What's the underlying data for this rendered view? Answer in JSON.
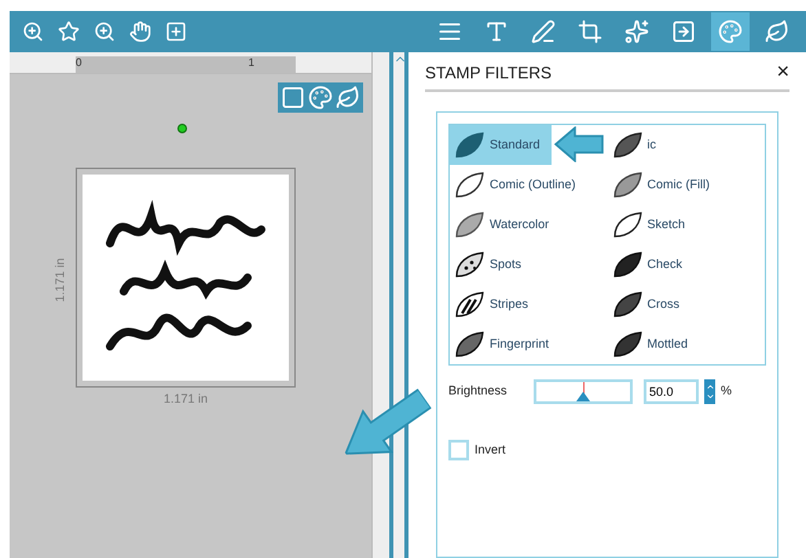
{
  "toolbar": {
    "left_tools": [
      {
        "selected": false
      },
      {
        "selected": false
      },
      {
        "selected": false
      },
      {
        "selected": false
      },
      {
        "selected": false
      }
    ],
    "right_tools": [
      {
        "selected": false
      },
      {
        "selected": false
      },
      {
        "selected": false
      },
      {
        "selected": false
      },
      {
        "selected": false
      },
      {
        "selected": false
      },
      {
        "selected": true
      },
      {
        "selected": false
      }
    ]
  },
  "ruler": {
    "labels": [
      "0",
      "1"
    ]
  },
  "canvas": {
    "width_label": "1.171 in",
    "height_label": "1.171 in"
  },
  "panel": {
    "title": "STAMP FILTERS",
    "close": "×",
    "filters": [
      {
        "label": "Standard",
        "selected": true
      },
      {
        "label": "ic",
        "selected": false
      },
      {
        "label": "Comic (Outline)",
        "selected": false
      },
      {
        "label": "Comic (Fill)",
        "selected": false
      },
      {
        "label": "Watercolor",
        "selected": false
      },
      {
        "label": "Sketch",
        "selected": false
      },
      {
        "label": "Spots",
        "selected": false
      },
      {
        "label": "Check",
        "selected": false
      },
      {
        "label": "Stripes",
        "selected": false
      },
      {
        "label": "Cross",
        "selected": false
      },
      {
        "label": "Fingerprint",
        "selected": false
      },
      {
        "label": "Mottled",
        "selected": false
      }
    ],
    "brightness": {
      "label": "Brightness",
      "level": 0.5,
      "value": "50.0",
      "unit": "%"
    },
    "invert": {
      "label": "Invert",
      "checked": false
    }
  }
}
